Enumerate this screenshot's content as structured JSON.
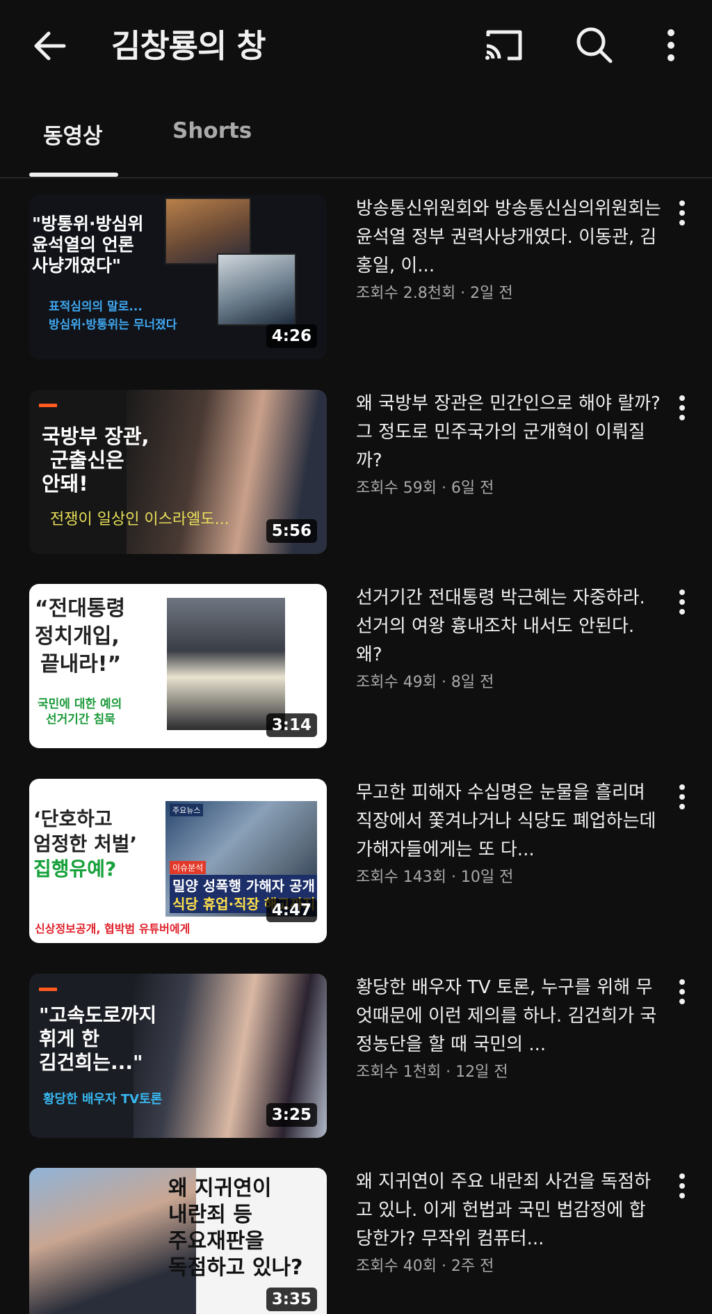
{
  "header": {
    "title": "김창룡의 창",
    "icons": [
      "arrow-back-icon",
      "cast-icon",
      "search-icon",
      "more-vert-icon"
    ]
  },
  "tabs": [
    {
      "label": "동영상",
      "selected": true
    },
    {
      "label": "Shorts",
      "selected": false
    }
  ],
  "videos": [
    {
      "title": "방송통신위원회와 방송통신심의위원회는 윤석열 정부 권력사냥개였다. 이동관, 김홍일, 이...",
      "meta": "조회수 2.8천회 · 2일 전",
      "duration": "4:26",
      "thumb": {
        "headline_1": "\"방통위·방심위",
        "headline_2": "윤석열의 언론",
        "headline_3": "사냥개였다\"",
        "sub_1": "표적심의의 말로...",
        "sub_2": "방심위·방통위는 무너졌다"
      }
    },
    {
      "title": "왜 국방부 장관은 민간인으로 해야 랄까? 그 정도로 민주국가의 군개혁이 이뤄질까?",
      "meta": "조회수 59회 · 6일 전",
      "duration": "5:56",
      "thumb": {
        "headline_1": "국방부 장관,",
        "headline_2": "군출신은",
        "headline_3": "안돼!",
        "sub_1": "전쟁이 일상인 이스라엘도..."
      }
    },
    {
      "title": "선거기간 전대통령 박근혜는 자중하라. 선거의 여왕 흉내조차 내서도 안된다. 왜?",
      "meta": "조회수 49회 · 8일 전",
      "duration": "3:14",
      "thumb": {
        "headline_1": "“전대통령",
        "headline_2": "정치개입,",
        "headline_3": "끝내라!”",
        "sub_1": "국민에 대한 예의",
        "sub_2": "선거기간 침묵"
      }
    },
    {
      "title": "무고한 피해자 수십명은 눈물을 흘리며 직장에서 쫓겨나거나 식당도 폐업하는데 가해자들에게는 또 다...",
      "meta": "조회수 143회 · 10일 전",
      "duration": "4:47",
      "thumb": {
        "headline_1": "‘단호하고",
        "headline_2": "엄정한 처벌’",
        "headline_3": "집행유예?",
        "sub_1": "신상정보공개, 협박범 유튜버에게",
        "badge_1": "주요뉴스",
        "badge_2": "이슈분석",
        "caption_1": "밀양 성폭행 가해자 공개",
        "caption_2": "식당 휴업·직장 해고까지"
      }
    },
    {
      "title": "황당한 배우자 TV 토론, 누구를 위해 무엇때문에 이런 제의를 하나. 김건희가 국정농단을 할 때 국민의 ...",
      "meta": "조회수 1천회 · 12일 전",
      "duration": "3:25",
      "thumb": {
        "headline_1": "\"고속도로까지",
        "headline_2": "휘게 한",
        "headline_3": "김건희는...\"",
        "sub_1": "황당한 배우자 TV토론"
      }
    },
    {
      "title": "왜 지귀연이 주요 내란죄 사건을 독점하고 있나. 이게 헌법과 국민 법감정에 합당한가? 무작위 컴퓨터...",
      "meta": "조회수 40회 · 2주 전",
      "duration": "3:35",
      "thumb": {
        "headline_1": "왜 지귀연이",
        "headline_2": "내란죄 등",
        "headline_3": "주요재판을",
        "headline_4": "독점하고 있나?"
      }
    }
  ]
}
